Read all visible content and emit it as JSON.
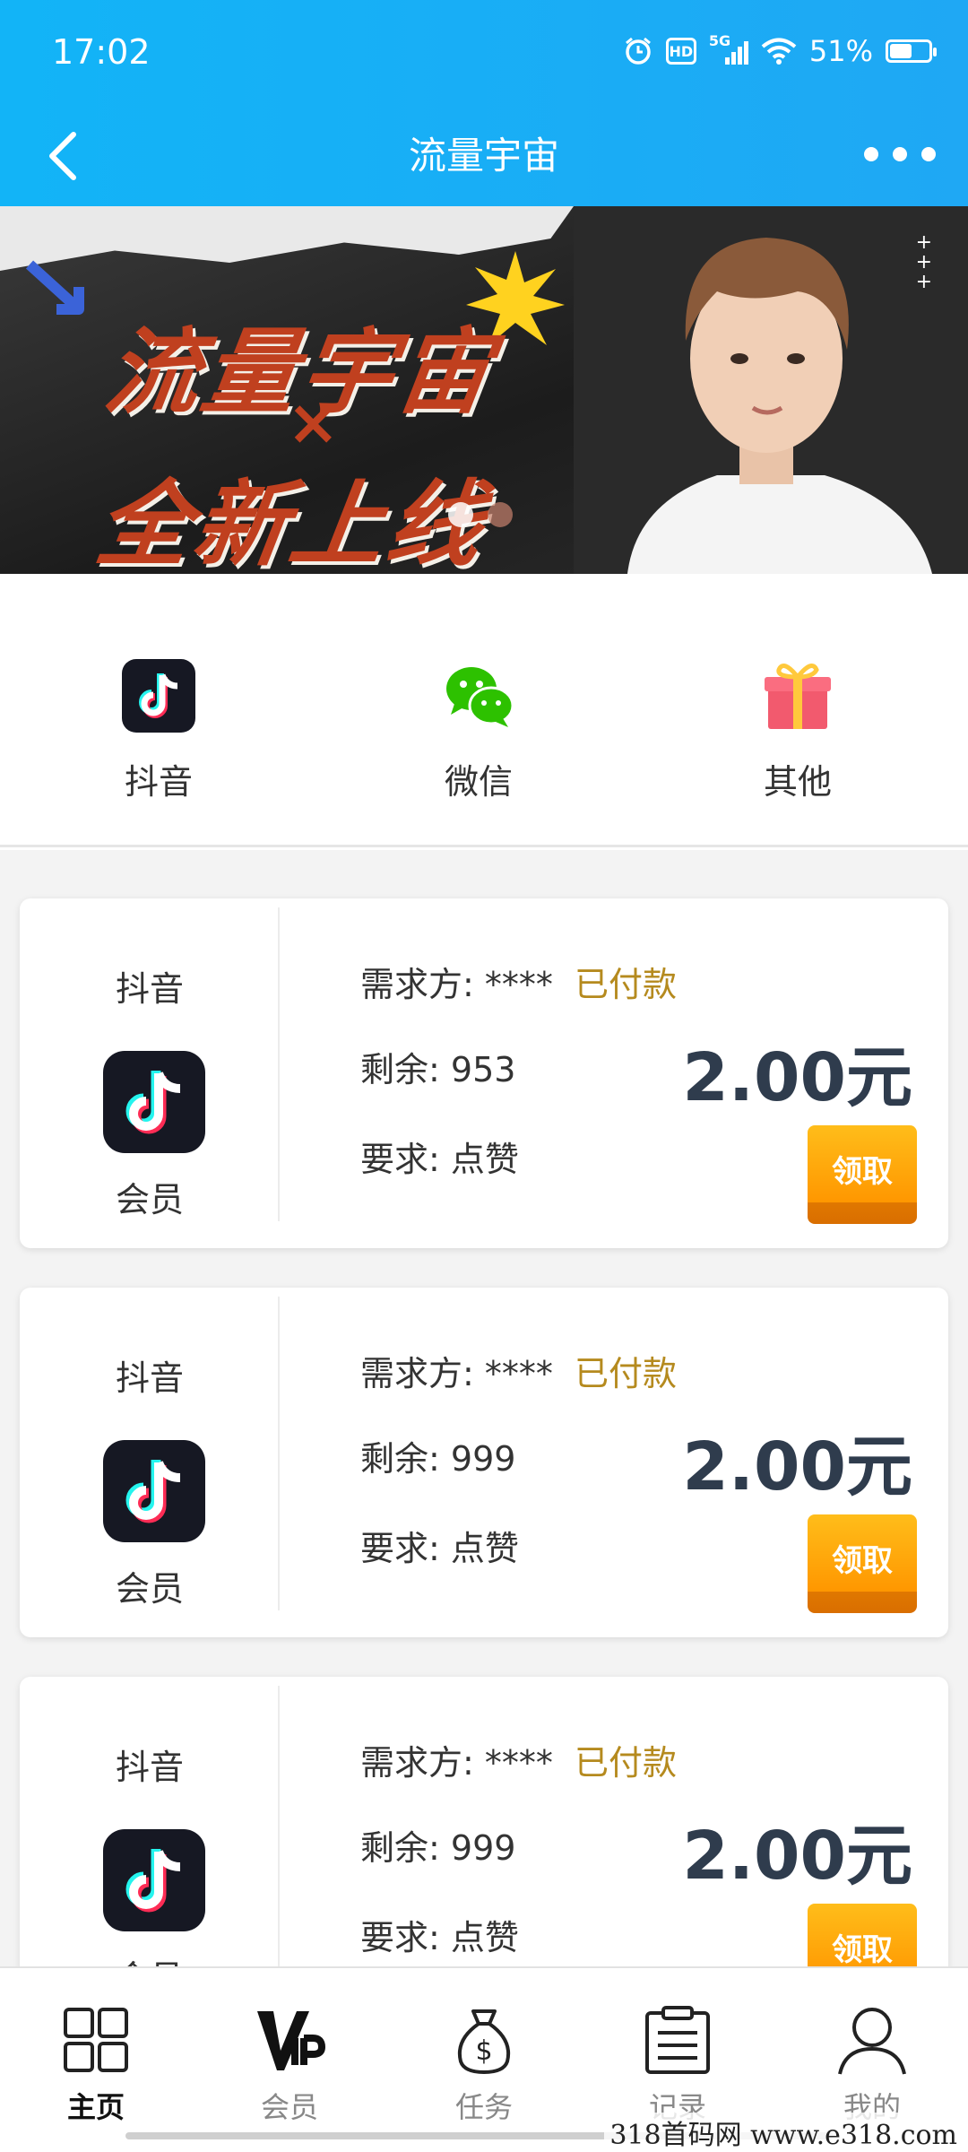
{
  "status_bar": {
    "time": "17:02",
    "network": "5G",
    "hd": "HD",
    "battery": "51%"
  },
  "nav": {
    "title": "流量宇宙"
  },
  "banner": {
    "line1": "流量宇宙",
    "x": "×",
    "line2": "全新上线",
    "active_slide": 1,
    "slide_count": 2
  },
  "categories": [
    {
      "label": "抖音",
      "icon": "douyin-icon"
    },
    {
      "label": "微信",
      "icon": "wechat-icon"
    },
    {
      "label": "其他",
      "icon": "gift-icon"
    }
  ],
  "tasks": [
    {
      "platform": "抖音",
      "member": "会员",
      "requester_label": "需求方:",
      "requester": "****",
      "status": "已付款",
      "remaining_label": "剩余:",
      "remaining": "953",
      "requirement_label": "要求:",
      "requirement": "点赞",
      "price": "2.00元",
      "claim": "领取"
    },
    {
      "platform": "抖音",
      "member": "会员",
      "requester_label": "需求方:",
      "requester": "****",
      "status": "已付款",
      "remaining_label": "剩余:",
      "remaining": "999",
      "requirement_label": "要求:",
      "requirement": "点赞",
      "price": "2.00元",
      "claim": "领取"
    },
    {
      "platform": "抖音",
      "member": "会员",
      "requester_label": "需求方:",
      "requester": "****",
      "status": "已付款",
      "remaining_label": "剩余:",
      "remaining": "999",
      "requirement_label": "要求:",
      "requirement": "点赞",
      "price": "2.00元",
      "claim": "领取"
    }
  ],
  "tabs": [
    {
      "label": "主页",
      "icon": "home-grid-icon",
      "active": true
    },
    {
      "label": "会员",
      "icon": "vip-icon",
      "active": false
    },
    {
      "label": "任务",
      "icon": "money-bag-icon",
      "active": false
    },
    {
      "label": "记录",
      "icon": "clipboard-icon",
      "active": false
    },
    {
      "label": "我的",
      "icon": "user-icon",
      "active": false
    }
  ],
  "watermark": "318首码网  www.e318.com"
}
